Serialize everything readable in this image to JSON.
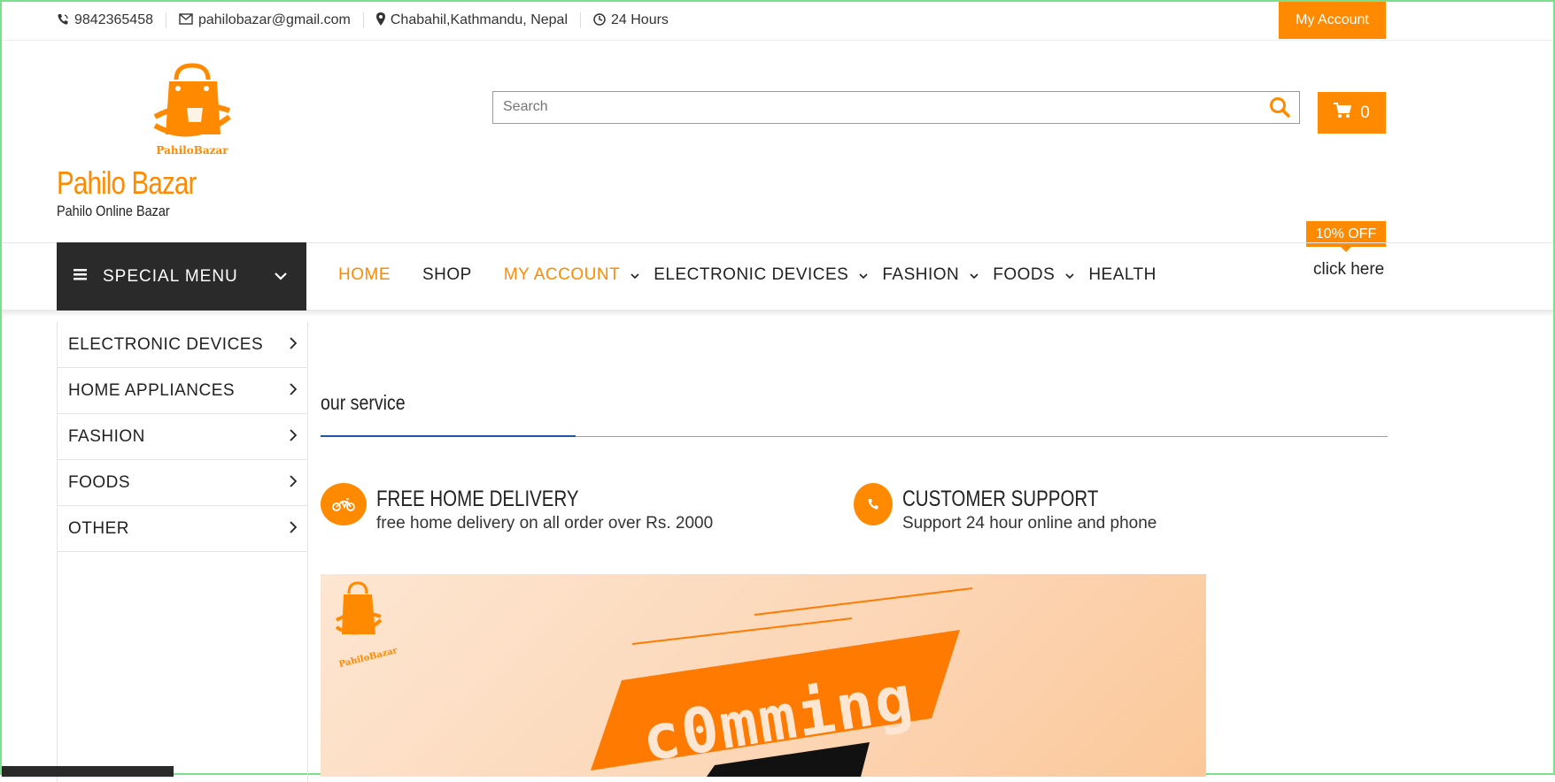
{
  "topbar": {
    "phone": "9842365458",
    "email": "pahilobazar@gmail.com",
    "location": "Chabahil,Kathmandu, Nepal",
    "hours": "24 Hours",
    "my_account": "My Account"
  },
  "header": {
    "logo_text": "PahiloBazar",
    "brand": "Pahilo Bazar",
    "tagline": "Pahilo Online Bazar",
    "search_placeholder": "Search",
    "cart_count": "0",
    "offer_badge": "10% OFF",
    "offer_link": "click here"
  },
  "nav": {
    "special_menu": "SPECIAL MENU",
    "items": [
      {
        "label": "HOME",
        "active": true,
        "dropdown": false
      },
      {
        "label": "SHOP",
        "active": false,
        "dropdown": false
      },
      {
        "label": "MY ACCOUNT",
        "active": true,
        "dropdown": true
      },
      {
        "label": "ELECTRONIC DEVICES",
        "active": false,
        "dropdown": true
      },
      {
        "label": "FASHION",
        "active": false,
        "dropdown": true
      },
      {
        "label": "FOODS",
        "active": false,
        "dropdown": true
      },
      {
        "label": "HEALTH",
        "active": false,
        "dropdown": false
      }
    ]
  },
  "sidebar": {
    "items": [
      {
        "label": "ELECTRONIC DEVICES"
      },
      {
        "label": "HOME APPLIANCES"
      },
      {
        "label": "FASHION"
      },
      {
        "label": "FOODS"
      },
      {
        "label": "OTHER"
      }
    ]
  },
  "services": {
    "title": "our service",
    "features": [
      {
        "title": "FREE HOME DELIVERY",
        "desc": "free home delivery on all order over Rs. 2000",
        "icon": "motorcycle-icon"
      },
      {
        "title": "CUSTOMER SUPPORT",
        "desc": "Support 24 hour online and phone",
        "icon": "phone-icon"
      }
    ]
  },
  "banner": {
    "logo_text": "PahiloBazar",
    "headline": "c0mming"
  },
  "colors": {
    "accent": "#ff8a00",
    "dark": "#2a2a2a",
    "blue_underline": "#2255aa"
  }
}
